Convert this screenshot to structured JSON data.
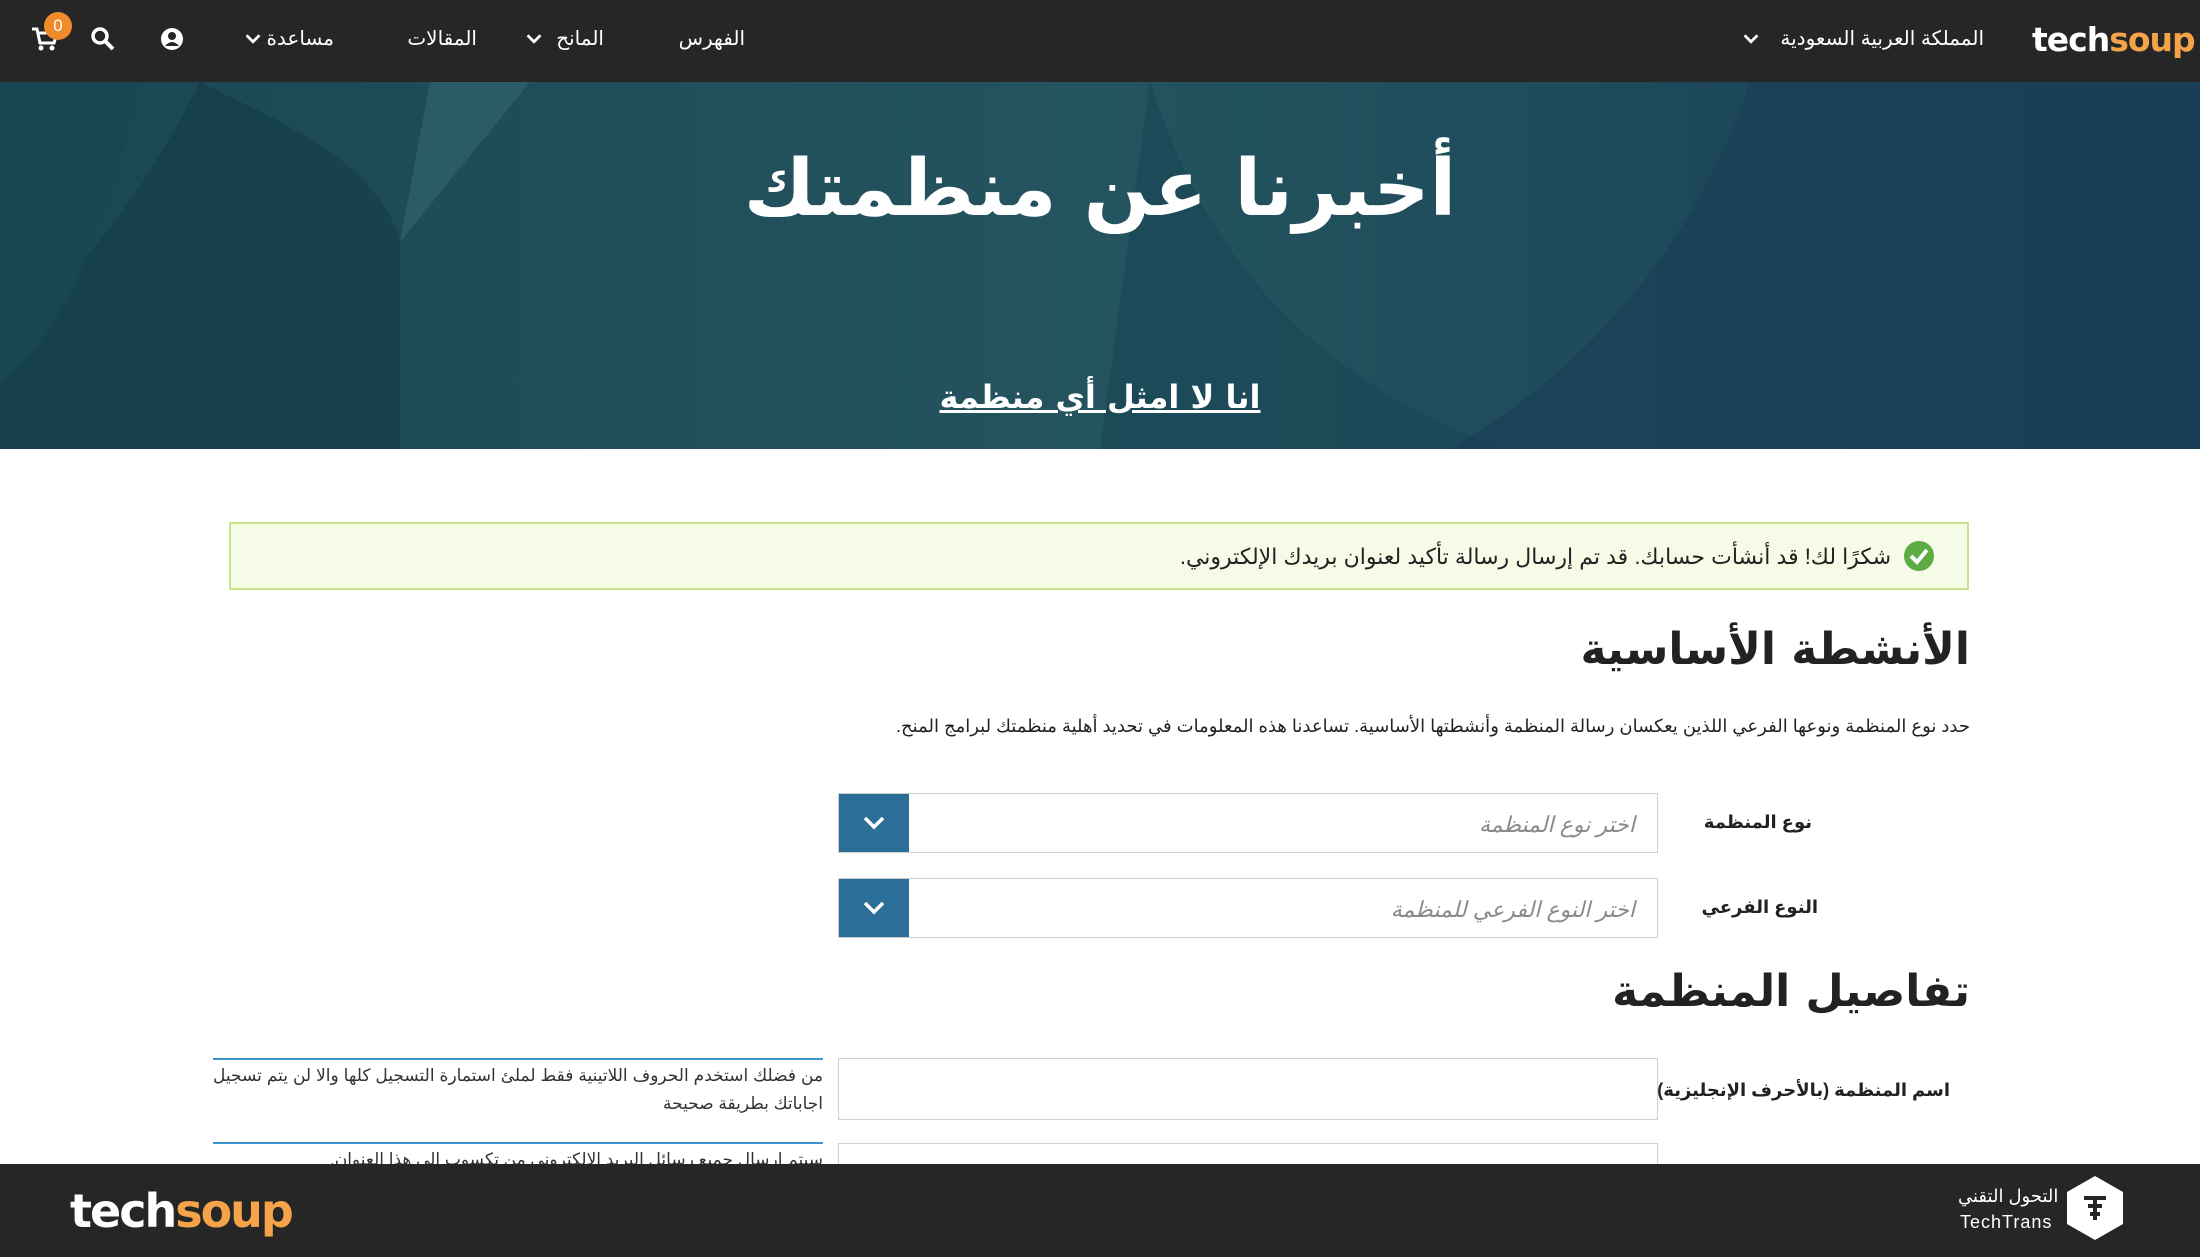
{
  "nav": {
    "logo_tech": "tech",
    "logo_soup": "soup",
    "region": "المملكة العربية السعودية",
    "catalog": "الفهرس",
    "grants": "المانح",
    "articles": "المقالات",
    "help": "مساعدة",
    "cart_count": "0",
    "icons": [
      "account-icon",
      "search-icon",
      "cart-icon"
    ]
  },
  "hero": {
    "title": "أخبرنا عن منظمتك",
    "not_org_link": "انا لا امثل أي منظمة"
  },
  "alert": {
    "message": "شكرًا لك! قد أنشأت حسابك. قد تم إرسال رسالة تأكيد لعنوان بريدك الإلكتروني.",
    "icon": "check-circle-icon",
    "color": "#6aa84f"
  },
  "core_activities": {
    "heading": "الأنشطة الأساسية",
    "description": "حدد نوع المنظمة ونوعها الفرعي اللذين يعكسان رسالة المنظمة وأنشطتها الأساسية. تساعدنا هذه المعلومات في تحديد أهلية منظمتك لبرامج المنح.",
    "org_type_label": "نوع المنظمة",
    "org_type_placeholder": "اختر نوع المنظمة",
    "subtype_label": "النوع الفرعي",
    "subtype_placeholder": "اختر النوع الفرعي للمنظمة"
  },
  "org_details": {
    "heading": "تفاصيل المنظمة",
    "name_label": "اسم المنظمة (بالأحرف الإنجليزية)",
    "name_value": "",
    "name_help": "من فضلك استخدم الحروف اللاتينية فقط لملئ استمارة التسجيل كلها والا لن يتم تسجيل اجاباتك بطريقة صحيحة",
    "email_help": "سيتم ارسال جميع رسائل البريد الإلكتروني من تكسوب الى هذا العنوان."
  },
  "footer": {
    "logo_tech": "tech",
    "logo_soup": "soup",
    "partner_ar": "التحول التقني",
    "partner_en": "TechTrans"
  },
  "colors": {
    "nav_bg": "#262626",
    "hero_bg": "#1e4a57",
    "accent_orange": "#f5a348",
    "select_button": "#2b6f98"
  }
}
